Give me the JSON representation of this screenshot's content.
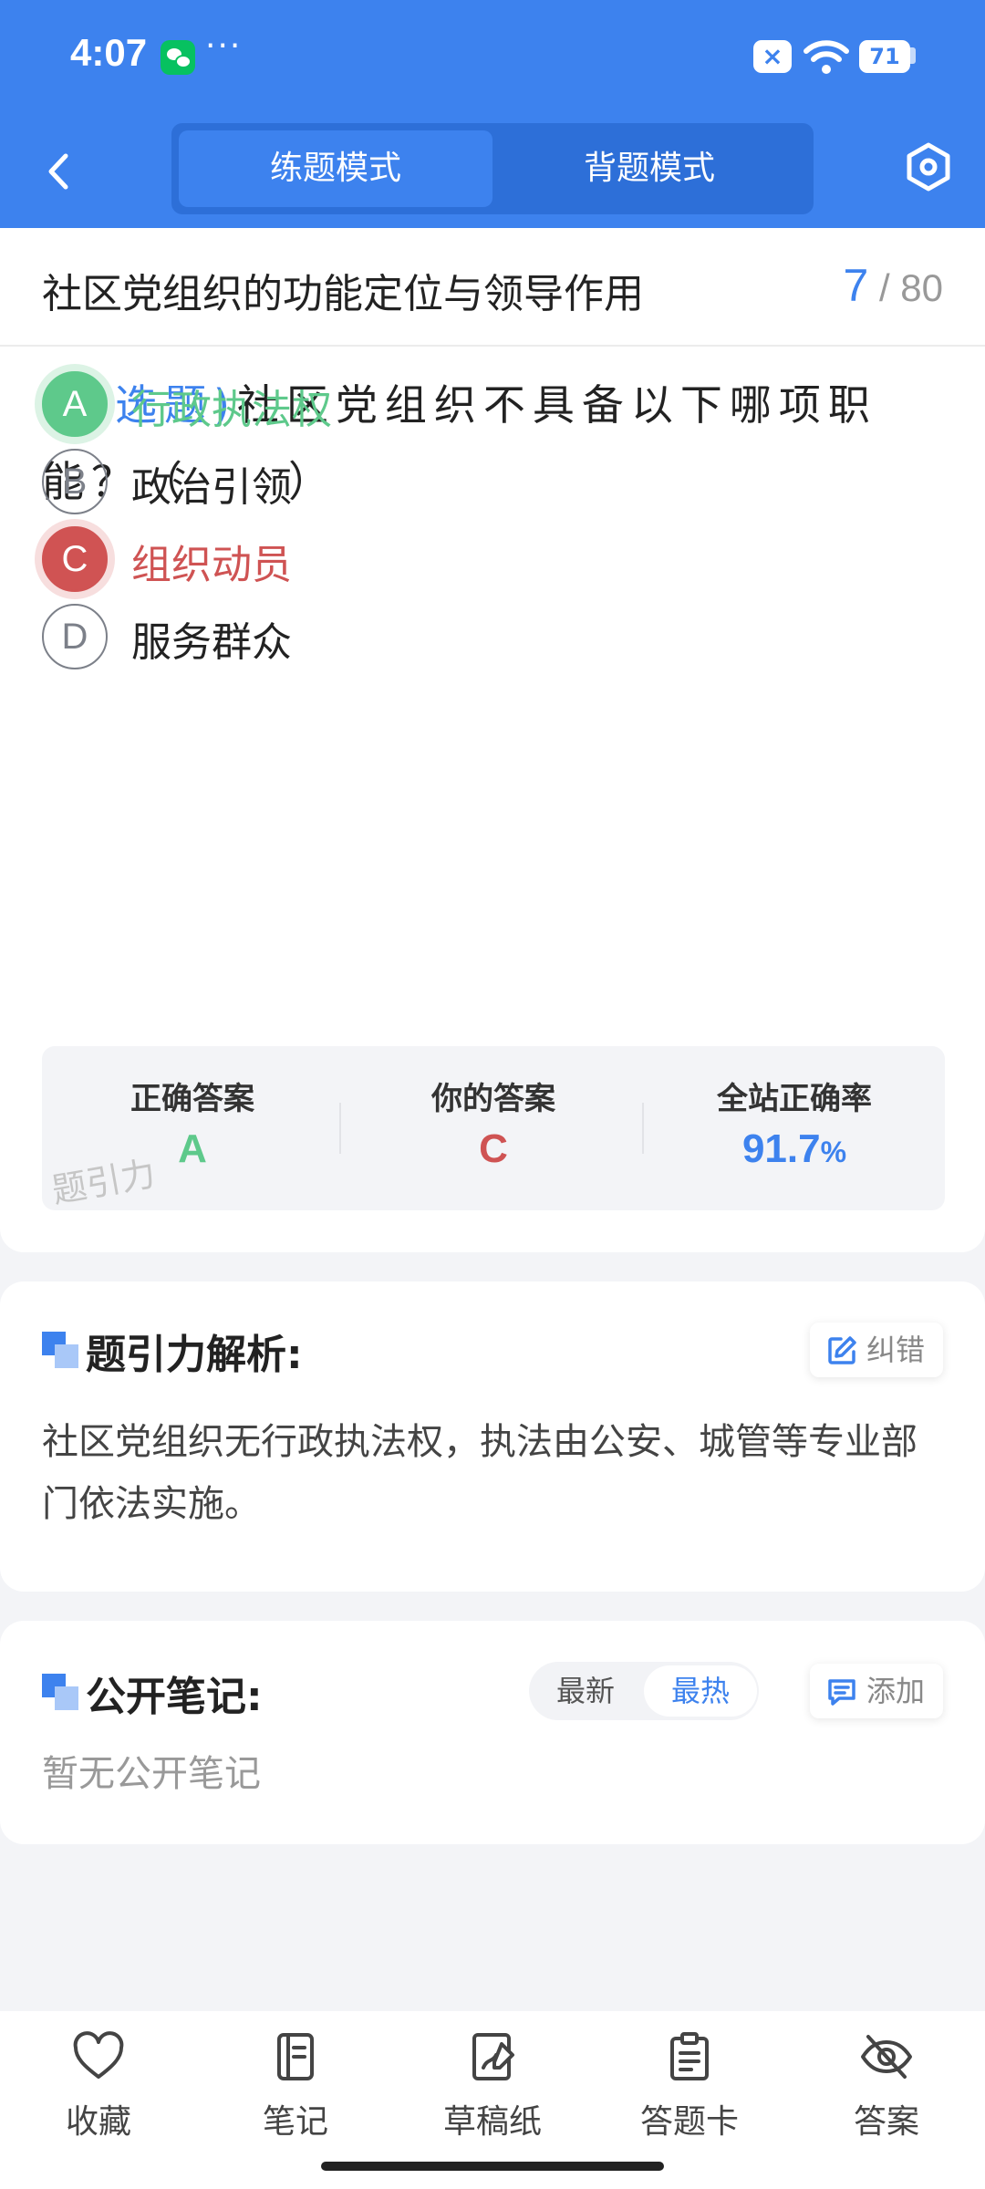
{
  "status_bar": {
    "time": "4:07",
    "dots": "···",
    "battery": "71"
  },
  "nav": {
    "tabs": [
      "练题模式",
      "背题模式"
    ],
    "active_tab": 0
  },
  "question": {
    "chapter_title": "社区党组织的功能定位与领导作用",
    "current": "7",
    "total": "/ 80",
    "type_label": "(单选题)",
    "text": "社区党组织不具备以下哪项职能？（　　）",
    "options": [
      {
        "letter": "A",
        "text": "行政执法权",
        "state": "correct"
      },
      {
        "letter": "B",
        "text": "政治引领",
        "state": "normal"
      },
      {
        "letter": "C",
        "text": "组织动员",
        "state": "wrong"
      },
      {
        "letter": "D",
        "text": "服务群众",
        "state": "normal"
      }
    ],
    "stats": {
      "correct_label": "正确答案",
      "correct_value": "A",
      "yours_label": "你的答案",
      "yours_value": "C",
      "rate_label": "全站正确率",
      "rate_value": "91.7",
      "rate_unit": "%"
    },
    "watermark": "题引力"
  },
  "analysis": {
    "title": "题引力解析:",
    "correct_btn": "纠错",
    "text": "社区党组织无行政执法权，执法由公安、城管等专业部门依法实施。"
  },
  "notes": {
    "title": "公开笔记:",
    "sort_options": [
      "最新",
      "最热"
    ],
    "active_sort": 1,
    "add_btn": "添加",
    "empty_text": "暂无公开笔记"
  },
  "bottom_bar": [
    {
      "label": "收藏",
      "icon": "heart-icon"
    },
    {
      "label": "笔记",
      "icon": "notebook-icon"
    },
    {
      "label": "草稿纸",
      "icon": "draft-paper-icon"
    },
    {
      "label": "答题卡",
      "icon": "answer-card-icon"
    },
    {
      "label": "答案",
      "icon": "eye-off-icon"
    }
  ],
  "colors": {
    "primary": "#3d82ee",
    "correct": "#5ec98b",
    "wrong": "#d05353"
  }
}
